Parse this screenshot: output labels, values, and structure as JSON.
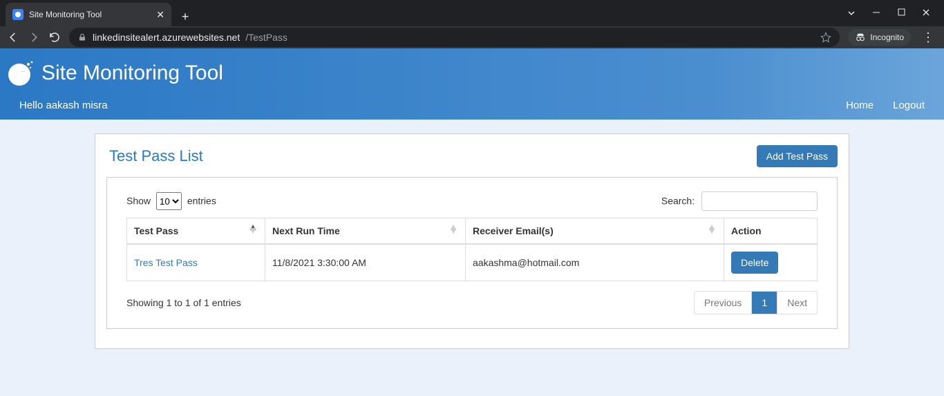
{
  "browser": {
    "tab_title": "Site Monitoring Tool",
    "url_domain": "linkedinsitealert.azurewebsites.net",
    "url_path": "/TestPass",
    "incognito": "Incognito"
  },
  "header": {
    "app_title": "Site Monitoring Tool",
    "greeting": "Hello aakash misra",
    "nav_home": "Home",
    "nav_logout": "Logout"
  },
  "page": {
    "title": "Test Pass List",
    "add_button": "Add Test Pass",
    "length_prefix": "Show",
    "length_value": "10",
    "length_suffix": "entries",
    "search_label": "Search:",
    "search_value": "",
    "columns": {
      "test_pass": "Test Pass",
      "next_run": "Next Run Time",
      "receiver": "Receiver Email(s)",
      "action": "Action"
    },
    "rows": [
      {
        "test_pass": "Tres Test Pass",
        "next_run": "11/8/2021 3:30:00 AM",
        "receiver": "aakashma@hotmail.com",
        "action": "Delete"
      }
    ],
    "info": "Showing 1 to 1 of 1 entries",
    "pager_prev": "Previous",
    "pager_current": "1",
    "pager_next": "Next"
  }
}
